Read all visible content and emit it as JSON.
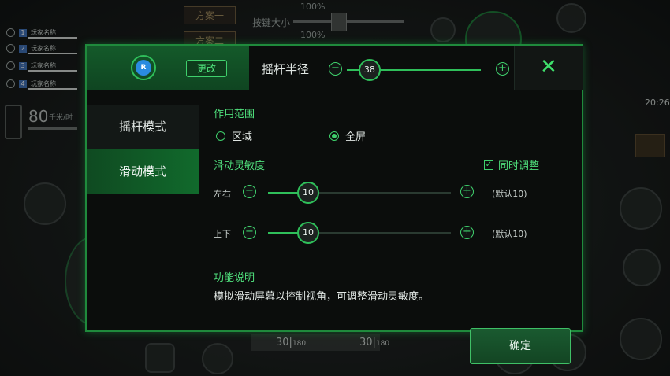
{
  "background_hud": {
    "scheme1": "方案一",
    "scheme2": "方案二",
    "button_size_label": "按键大小",
    "percent_top": "100%",
    "percent_mid": "100%",
    "players": [
      {
        "num": "1",
        "name": "玩家名称"
      },
      {
        "num": "2",
        "name": "玩家名称"
      },
      {
        "num": "3",
        "name": "玩家名称"
      },
      {
        "num": "4",
        "name": "玩家名称"
      }
    ],
    "distance": "80",
    "distance_unit": "千米/时",
    "time": "20:26",
    "ammo_left": "30",
    "ammo_left_total": "180",
    "ammo_right": "30",
    "ammo_right_total": "180"
  },
  "header": {
    "avatar_letter": "R",
    "change_button": "更改",
    "radius_label": "摇杆半径",
    "radius_value": "38",
    "radius_fraction": 0.17,
    "close_icon": "close-icon"
  },
  "sidebar": {
    "items": [
      {
        "label": "摇杆模式",
        "active": false
      },
      {
        "label": "滑动模式",
        "active": true
      }
    ]
  },
  "content": {
    "scope_title": "作用范围",
    "scope_options": [
      {
        "label": "区域",
        "selected": false
      },
      {
        "label": "全屏",
        "selected": true
      }
    ],
    "sensitivity_title": "滑动灵敏度",
    "sync_label": "同时调整",
    "sync_checked": true,
    "sliders": [
      {
        "label": "左右",
        "value": "10",
        "default": "(默认10)",
        "fraction": 0.22
      },
      {
        "label": "上下",
        "value": "10",
        "default": "(默认10)",
        "fraction": 0.22
      }
    ],
    "func_title": "功能说明",
    "func_desc": "模拟滑动屏幕以控制视角，可调整滑动灵敏度。",
    "confirm_button": "确定"
  },
  "colors": {
    "accent": "#3fd06c",
    "panel_bg": "#0b0d0c",
    "active_tab": "#116a2c"
  }
}
